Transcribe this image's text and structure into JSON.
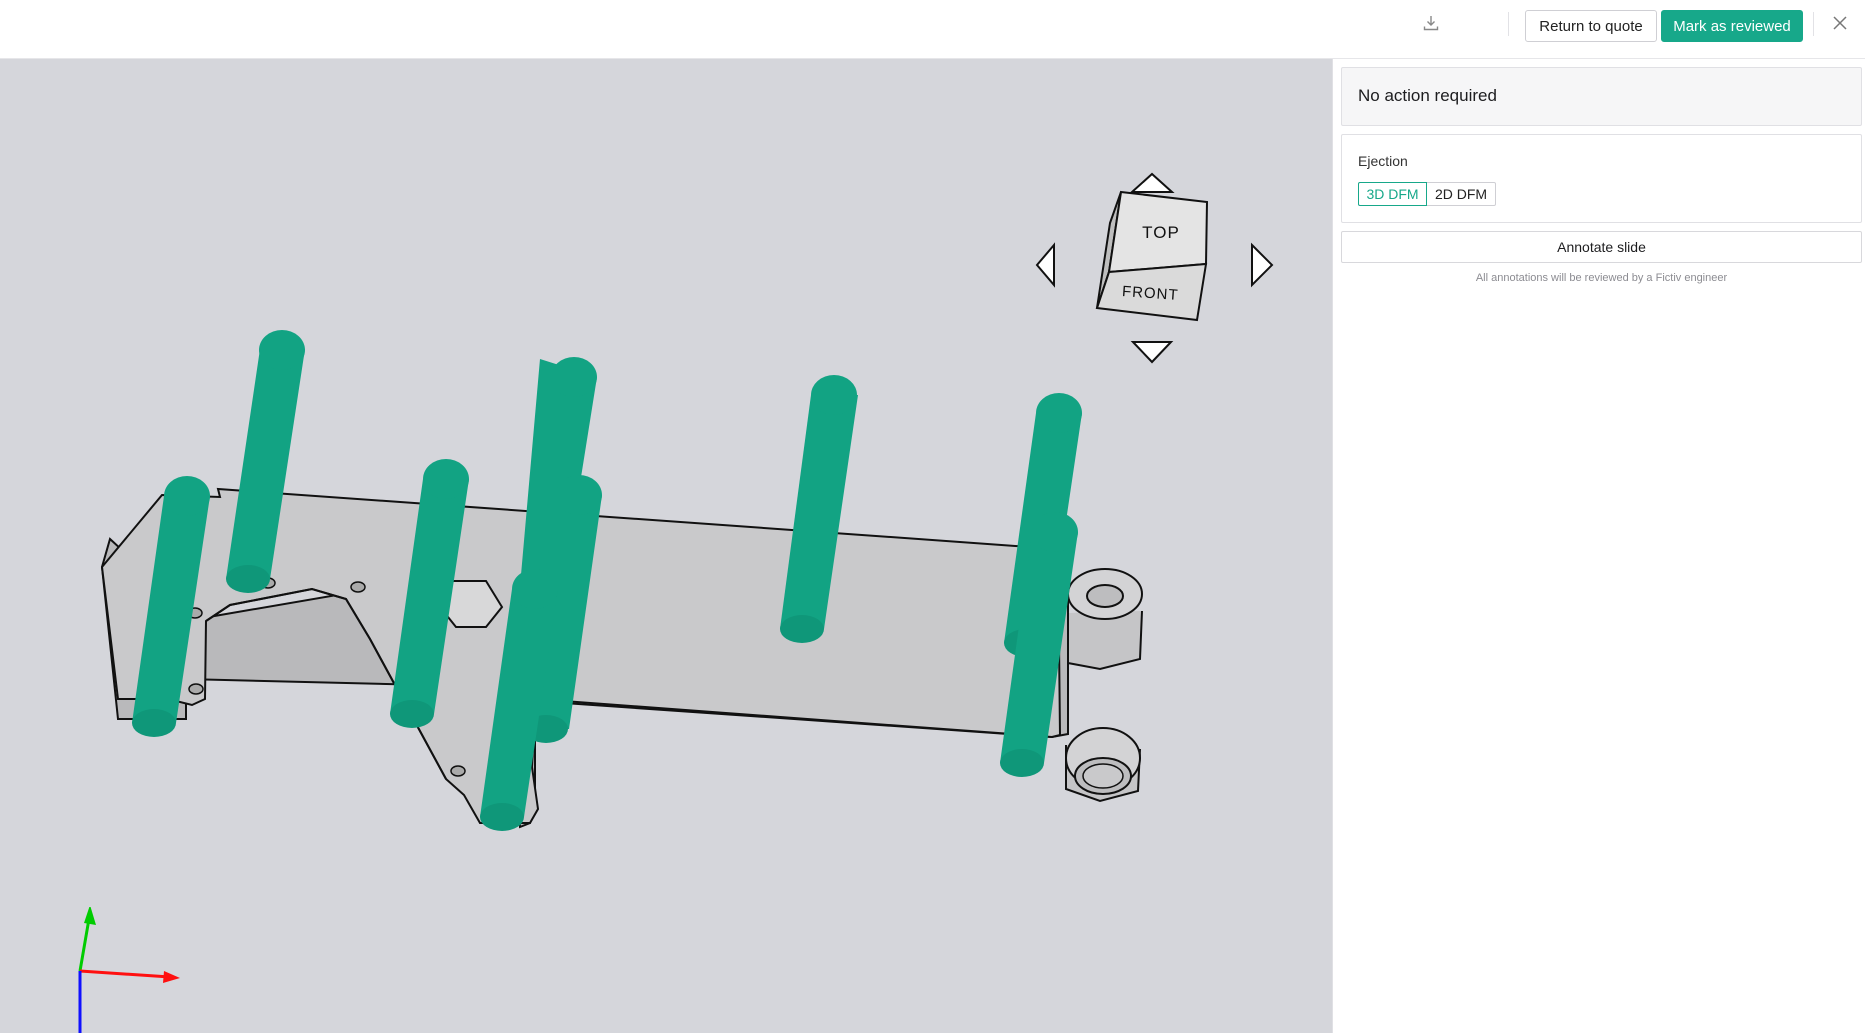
{
  "header": {
    "download_icon": "download-icon",
    "return_label": "Return to quote",
    "review_label": "Mark as reviewed",
    "close_icon": "close-icon"
  },
  "panel": {
    "status": "No action required",
    "ejection_label": "Ejection",
    "tabs": [
      "3D DFM",
      "2D DFM"
    ],
    "selected_tab": "3D DFM",
    "annotate_label": "Annotate slide",
    "note": "All annotations will be reviewed by a Fictiv engineer"
  },
  "viewer": {
    "cube_top": "TOP",
    "cube_front": "FRONT",
    "colors": {
      "accent": "#17a88a",
      "pin": "#12a383",
      "part": "#c9c9cb",
      "background": "#d5d6db"
    }
  }
}
